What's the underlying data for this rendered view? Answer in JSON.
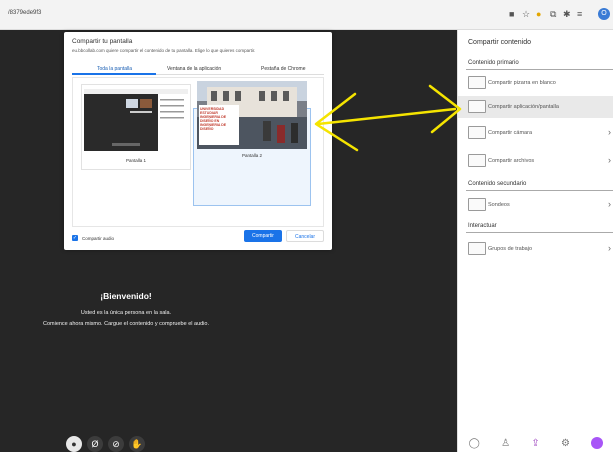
{
  "browser": {
    "url": "/8379ede9f3",
    "icons": [
      "camera-icon",
      "star-icon",
      "extension-icon",
      "puzzle-icon",
      "pin-icon",
      "menu-icon"
    ],
    "avatar_letter": "O"
  },
  "stage": {
    "welcome": "¡Bienvenido!",
    "message_line1": "Usted es la única persona en la sala.",
    "message_line2": "Comience ahora mismo. Cargue el contenido y compruebe el audio.",
    "controls": [
      "user-icon",
      "mic-off-icon",
      "camera-off-icon",
      "hand-icon"
    ]
  },
  "dialog": {
    "title": "Compartir tu pantalla",
    "subtitle": "eu.bbcollab.com quiere compartir el contenido de tu pantalla. Elige lo que quieres compartir.",
    "tabs": [
      "Toda la pantalla",
      "Ventana de la aplicación",
      "Pestaña de Chrome"
    ],
    "active_tab": 0,
    "screens": [
      {
        "label": "Pantalla 1"
      },
      {
        "label": "Pantalla 2"
      }
    ],
    "preview_text": [
      "UNIVERSIDAD",
      "ESTUDIAR",
      "INGENIERIA DE",
      "DISEÑO EN",
      "INGENIERIA DE",
      "DISEÑO"
    ],
    "audio_label": "Compartir audio",
    "audio_checked": true,
    "share_button": "Compartir",
    "cancel_button": "Cancelar"
  },
  "panel": {
    "title": "Compartir contenido",
    "primary_label": "Contenido primario",
    "primary_items": [
      {
        "label": "Compartir pizarra en blanco",
        "icon": "whiteboard-icon",
        "chevron": false
      },
      {
        "label": "Compartir aplicación/pantalla",
        "icon": "screen-share-icon",
        "chevron": false,
        "highlight": true
      },
      {
        "label": "Compartir cámara",
        "icon": "camera-icon",
        "chevron": true
      },
      {
        "label": "Compartir archivos",
        "icon": "folder-icon",
        "chevron": true
      }
    ],
    "secondary_label": "Contenido secundario",
    "secondary_items": [
      {
        "label": "Sondeos",
        "icon": "poll-icon",
        "chevron": true
      }
    ],
    "interact_label": "Interactuar",
    "interact_items": [
      {
        "label": "Grupos de trabajo",
        "icon": "groups-icon",
        "chevron": true
      }
    ],
    "bottom_icons": [
      "chat-icon",
      "people-icon",
      "share-content-icon",
      "settings-icon"
    ]
  },
  "colors": {
    "accent": "#1a73e8",
    "annotation": "#f5e400",
    "stage": "#262626"
  }
}
